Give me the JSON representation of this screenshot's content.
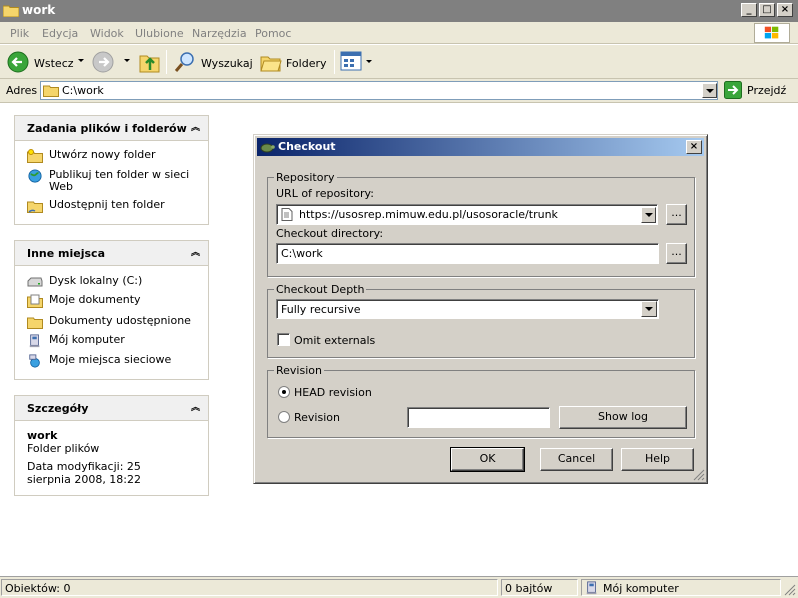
{
  "window": {
    "title": "work"
  },
  "menu": [
    "Plik",
    "Edycja",
    "Widok",
    "Ulubione",
    "Narzędzia",
    "Pomoc"
  ],
  "toolbar": {
    "back": "Wstecz",
    "search": "Wyszukaj",
    "folders": "Foldery"
  },
  "address": {
    "label": "Adres",
    "value": "C:\\work",
    "go": "Przejdź"
  },
  "panels": {
    "tasks": {
      "title": "Zadania plików i folderów",
      "items": [
        "Utwórz nowy folder",
        "Publikuj ten folder w sieci Web",
        "Udostępnij ten folder"
      ]
    },
    "places": {
      "title": "Inne miejsca",
      "items": [
        "Dysk lokalny (C:)",
        "Moje dokumenty",
        "Dokumenty udostępnione",
        "Mój komputer",
        "Moje miejsca sieciowe"
      ]
    },
    "details": {
      "title": "Szczegóły",
      "name": "work",
      "type": "Folder plików",
      "modified": "Data modyfikacji: 25 sierpnia 2008, 18:22"
    }
  },
  "dialog": {
    "title": "Checkout",
    "repository": {
      "group": "Repository",
      "url_label": "URL of repository:",
      "url_value": "https://usosrep.mimuw.edu.pl/usosoracle/trunk",
      "dir_label": "Checkout directory:",
      "dir_value": "C:\\work",
      "browse": "..."
    },
    "depth": {
      "group": "Checkout Depth",
      "value": "Fully recursive",
      "omit": "Omit externals"
    },
    "revision": {
      "group": "Revision",
      "head": "HEAD revision",
      "rev": "Revision",
      "show_log": "Show log"
    },
    "buttons": {
      "ok": "OK",
      "cancel": "Cancel",
      "help": "Help"
    }
  },
  "status": {
    "objects": "Obiektów: 0",
    "size": "0 bajtów",
    "location": "Mój komputer"
  },
  "colors": {
    "dialog_title_start": "#0a246a",
    "dialog_title_end": "#a6caf0",
    "chrome": "#ece9d8"
  }
}
